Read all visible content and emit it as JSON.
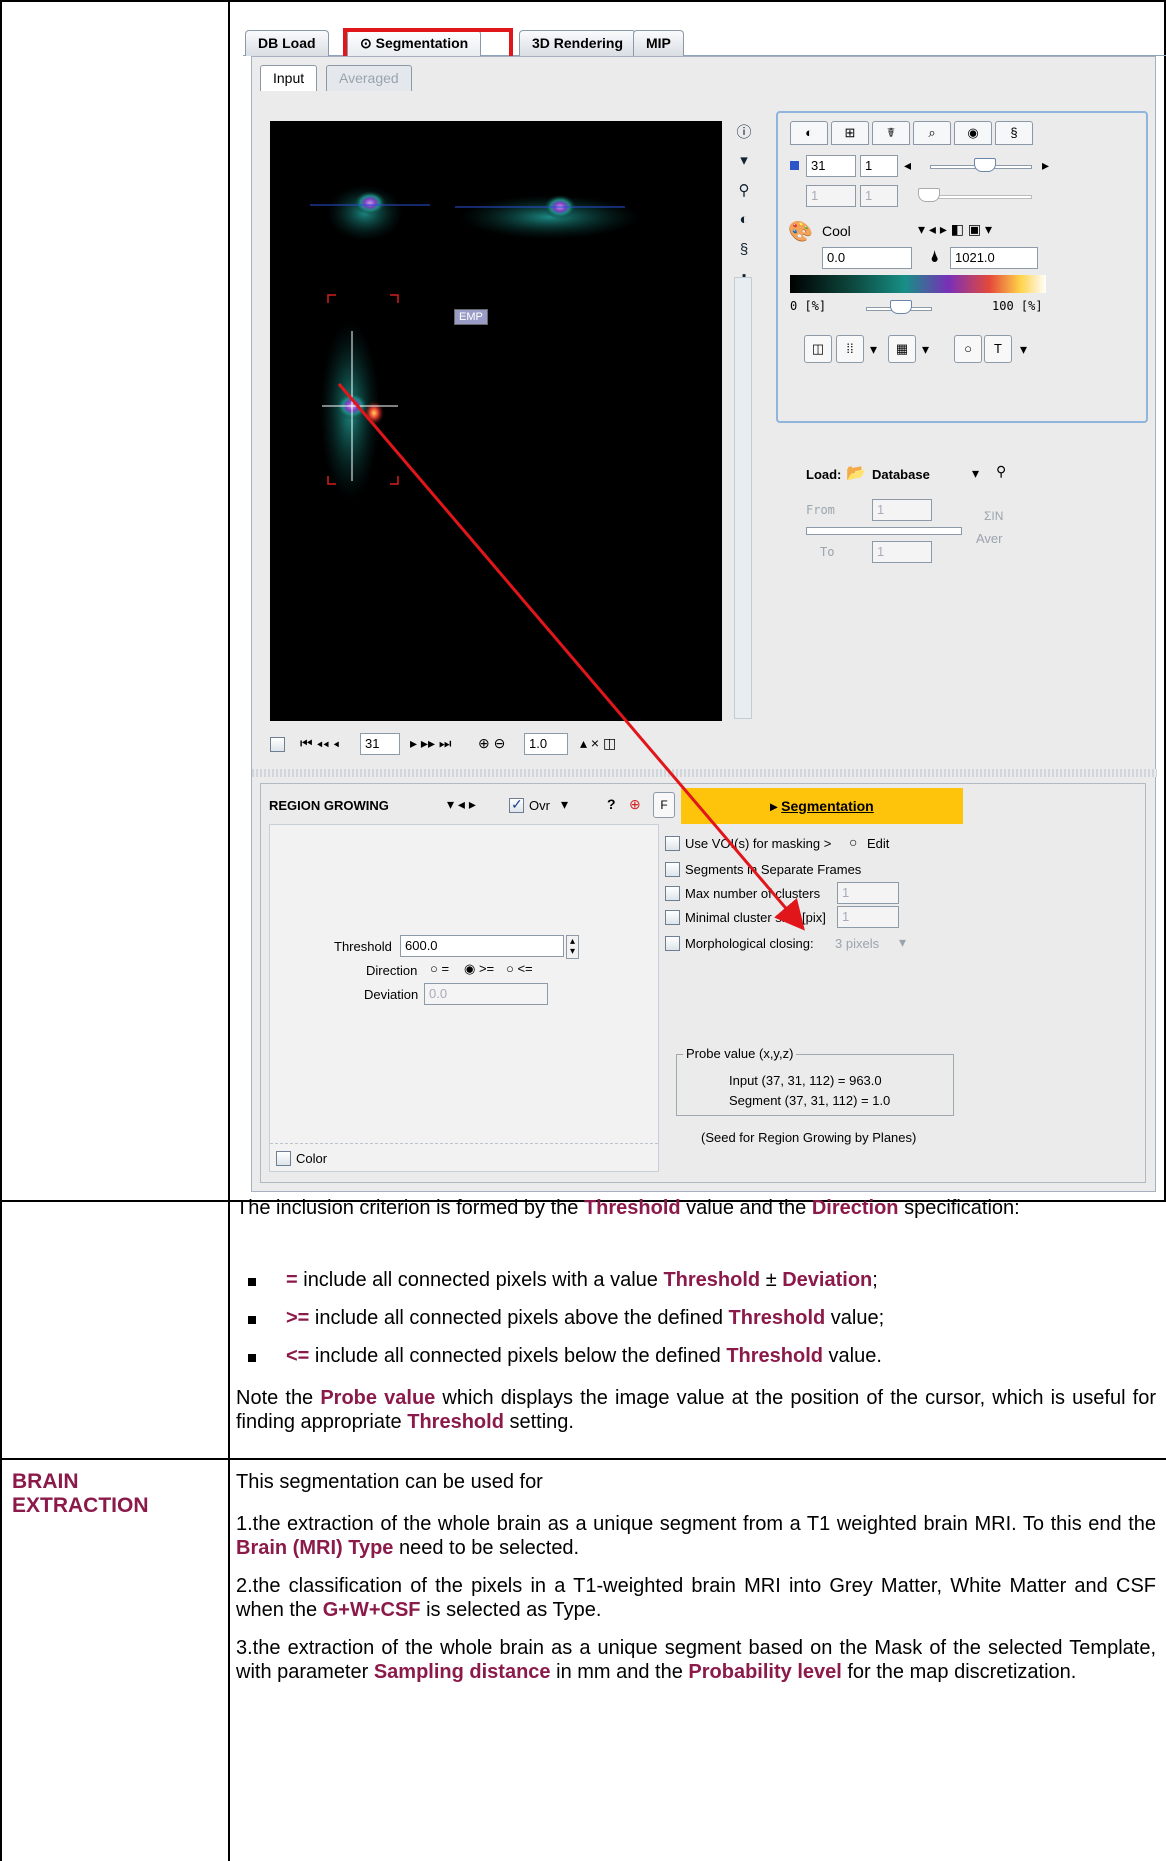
{
  "main_tabs": [
    "DB Load",
    "Segmentation",
    "3D Rendering",
    "MIP"
  ],
  "sub_tabs": [
    "Input",
    "Averaged"
  ],
  "viewer": {
    "overlay_tag": "EMP"
  },
  "right_panel": {
    "tab_icons": [
      "contrast-icon",
      "grid-icon",
      "person-icon",
      "chart-icon",
      "broadcast-icon",
      "figure-icon"
    ],
    "slice_value": "31",
    "frame_value": "1",
    "slice_value_disabled": "1",
    "frame_value_disabled": "1",
    "colormap": "Cool",
    "min_value": "0.0",
    "max_value": "1021.0",
    "pct_min": "0  [%]",
    "pct_max": "100  [%]"
  },
  "load": {
    "label": "Load:",
    "source": "Database",
    "from_label": "From",
    "to_label": "To",
    "from_value": "1",
    "to_value": "1",
    "sum_label": "ΣIN",
    "aver_label": "Aver"
  },
  "viewer_toolbar": {
    "slice": "31",
    "zoom": "1.0"
  },
  "segmentation": {
    "method": "REGION GROWING",
    "ovr_label": "Ovr",
    "f_label": "F",
    "button_label": "Segmentation",
    "threshold_label": "Threshold",
    "threshold_value": "600.0",
    "direction_label": "Direction",
    "direction_options": [
      "=",
      ">=",
      "<="
    ],
    "deviation_label": "Deviation",
    "deviation_value": "0.0",
    "color_label": "Color",
    "options": {
      "use_voi": "Use VOI(s) for masking >",
      "edit": "Edit",
      "separate_frames": "Segments in Separate Frames",
      "max_clusters": "Max number of clusters",
      "max_clusters_value": "1",
      "min_cluster_size": "Minimal cluster size [pix]",
      "min_cluster_size_value": "1",
      "morph_closing": "Morphological closing:",
      "morph_value": "3 pixels"
    },
    "probe": {
      "title": "Probe value (x,y,z)",
      "input_line": "Input (37, 31, 112) = 963.0",
      "segment_line": "Segment (37, 31, 112) = 1.0"
    },
    "seed_note": "(Seed for Region Growing by Planes)"
  },
  "text": {
    "intro_a": "The inclusion criterion is formed by the ",
    "intro_threshold": "Threshold",
    "intro_b": " value and the ",
    "intro_direction": "Direction",
    "intro_c": " specification:",
    "b1_sym": "=",
    "b1_a": " include all connected pixels with a value ",
    "b1_threshold": "Threshold",
    "b1_pm": " ± ",
    "b1_deviation": "Deviation",
    "b1_end": ";",
    "b2_sym": ">=",
    "b2_a": " include all connected pixels above the defined ",
    "b2_threshold": "Threshold",
    "b2_end": " value;",
    "b3_sym": "<=",
    "b3_a": " include all connected pixels below the defined ",
    "b3_threshold": "Threshold",
    "b3_end": " value.",
    "note_a": "Note the ",
    "note_probe": "Probe value",
    "note_b": " which displays the image value at the position of the cursor, which is useful for finding appropriate ",
    "note_threshold": "Threshold",
    "note_c": " setting.",
    "brain_label_1": "BRAIN",
    "brain_label_2": "EXTRACTION",
    "brain_intro": "This segmentation can be used for",
    "p1_a": "1.the extraction of the whole brain as a unique segment from a T1 weighted brain MRI. To this end the ",
    "p1_type": "Brain (MRI) Type",
    "p1_b": " need to be selected.",
    "p2_a": "2.the classification of the pixels in a T1-weighted brain MRI into Grey Matter, White Matter and CSF when the ",
    "p2_type": "G+W+CSF",
    "p2_b": " is selected as Type.",
    "p3_a": "3.the extraction of the whole brain as a unique segment based on the Mask of the selected Template, with parameter ",
    "p3_sampling": "Sampling distance",
    "p3_b": " in mm and the ",
    "p3_prob": "Probability level",
    "p3_c": " for the map discretization."
  }
}
